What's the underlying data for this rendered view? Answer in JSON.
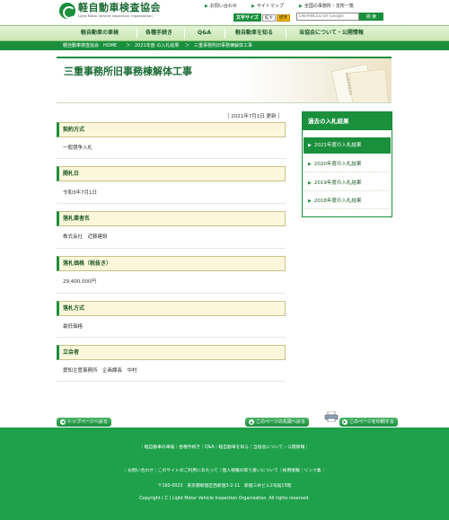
{
  "header": {
    "logo_ja": "軽自動車検査協会",
    "logo_en": "Light Motor Vehicle Inspection Organization",
    "toplinks": [
      "お問い合わせ",
      "サイトマップ",
      "全国の事務所・支所一覧"
    ],
    "font_size_label": "文字サイズ",
    "font_size_options": [
      "標準",
      "拡大"
    ],
    "search_placeholder": "ENHANCED BY Google",
    "search_button": "検 索"
  },
  "nav": {
    "items": [
      "軽自動車の車検",
      "各種手続き",
      "Q&A",
      "軽自動車を知る",
      "当協会について・公開情報"
    ]
  },
  "breadcrumb": {
    "items": [
      "軽自動車検査協会　HOME",
      "＞",
      "2021年度 の入札結果",
      "＞",
      "三重事務所旧事務棟解体工事"
    ]
  },
  "page": {
    "title": "三重事務所旧事務棟解体工事",
    "deco_text": "軽自動車検査協会",
    "updated": "［ 2021年7月1日 更新 ］"
  },
  "sections": [
    {
      "heading": "契約方式",
      "value": "一般競争入札"
    },
    {
      "heading": "開札日",
      "value": "令和3年7月1日"
    },
    {
      "heading": "落札業者名",
      "value": "株式会社　近藤建設"
    },
    {
      "heading": "落札価格（税抜き）",
      "value": "29,400,000円"
    },
    {
      "heading": "落札方式",
      "value": "最低価格"
    },
    {
      "heading": "立会者",
      "value": "愛知主管事務所　企画課長　中村"
    }
  ],
  "sidebar": {
    "heading": "過去の入札結果",
    "items": [
      "2021年度の入札結果",
      "2020年度の入札結果",
      "2019年度の入札結果",
      "2018年度の入札結果"
    ]
  },
  "buttons": {
    "back_top": "トップページへ戻る",
    "page_top": "このページの先頭へ戻る",
    "print": "このページを印刷する"
  },
  "footer": {
    "nav_line": "｜軽自動車の車検｜各種手続き｜Q&A｜軽自動車を知る｜当協会について・公開情報｜",
    "link_line": "｜お問い合わせ｜このサイトのご利用にあたって｜個人情報の取り扱いについて｜採用情報｜リンク集｜",
    "address": "〒160-0023　東京都新宿区西新宿3-2-11　新宿三井ビル2号館15階",
    "copyright": "Copyright ( C ) Light Motor Vehicle Inspection Organization. All rights reserved."
  },
  "colors": {
    "brand_green": "#1a8f3c",
    "footer_green": "#1fa14b",
    "section_bg": "#fcf7dc"
  }
}
